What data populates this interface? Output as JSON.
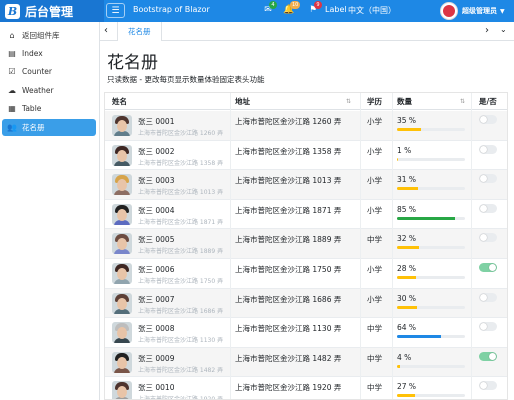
{
  "header": {
    "logo_letter": "B",
    "brand_title": "后台管理",
    "app_name": "Bootstrap of Blazor",
    "icons": [
      {
        "name": "mail-icon",
        "glyph": "✉",
        "badge": "4",
        "color": "#28a745"
      },
      {
        "name": "bell-icon",
        "glyph": "🔔",
        "badge": "10",
        "color": "#f0ad4e"
      },
      {
        "name": "flag-icon",
        "glyph": "⚑",
        "badge": "9",
        "color": "#dc3545"
      }
    ],
    "label_text": "Label",
    "language": "中文（中国）",
    "user_name": "超级管理员"
  },
  "sidebar": {
    "items": [
      {
        "icon": "⌂",
        "icon_name": "home-icon",
        "label": "返回组件库"
      },
      {
        "icon": "▤",
        "icon_name": "document-icon",
        "label": "Index"
      },
      {
        "icon": "☑",
        "icon_name": "checkbox-icon",
        "label": "Counter"
      },
      {
        "icon": "☁",
        "icon_name": "cloud-icon",
        "label": "Weather"
      },
      {
        "icon": "▦",
        "icon_name": "table-icon",
        "label": "Table"
      },
      {
        "icon": "👥",
        "icon_name": "users-icon",
        "label": "花名册"
      }
    ],
    "active_index": 5
  },
  "tabs": {
    "prev": "‹",
    "next": "›",
    "more": "⌄",
    "active_label": "花名册"
  },
  "page": {
    "title": "花名册",
    "description": "只读数据 - 更改每页显示数量体验固定表头功能"
  },
  "table": {
    "columns": {
      "name": "姓名",
      "address": "地址",
      "education": "学历",
      "count": "数量",
      "yes_no": "是/否"
    },
    "sort_glyph": "⇅",
    "rows": [
      {
        "name": "张三 0001",
        "sub": "上海市普陀区金沙江路 1260 弄",
        "address": "上海市普陀区金沙江路 1260 弄",
        "education": "小学",
        "pct_label": "35 %",
        "pct": 35,
        "bar_color": "#ffc107",
        "on": false
      },
      {
        "name": "张三 0002",
        "sub": "上海市普陀区金沙江路 1358 弄",
        "address": "上海市普陀区金沙江路 1358 弄",
        "education": "小学",
        "pct_label": "1 %",
        "pct": 1,
        "bar_color": "#ffc107",
        "on": false
      },
      {
        "name": "张三 0003",
        "sub": "上海市普陀区金沙江路 1013 弄",
        "address": "上海市普陀区金沙江路 1013 弄",
        "education": "小学",
        "pct_label": "31 %",
        "pct": 31,
        "bar_color": "#ffc107",
        "on": false
      },
      {
        "name": "张三 0004",
        "sub": "上海市普陀区金沙江路 1871 弄",
        "address": "上海市普陀区金沙江路 1871 弄",
        "education": "小学",
        "pct_label": "85 %",
        "pct": 85,
        "bar_color": "#28a745",
        "on": false
      },
      {
        "name": "张三 0005",
        "sub": "上海市普陀区金沙江路 1889 弄",
        "address": "上海市普陀区金沙江路 1889 弄",
        "education": "中学",
        "pct_label": "32 %",
        "pct": 32,
        "bar_color": "#ffc107",
        "on": false
      },
      {
        "name": "张三 0006",
        "sub": "上海市普陀区金沙江路 1750 弄",
        "address": "上海市普陀区金沙江路 1750 弄",
        "education": "小学",
        "pct_label": "28 %",
        "pct": 28,
        "bar_color": "#ffc107",
        "on": true
      },
      {
        "name": "张三 0007",
        "sub": "上海市普陀区金沙江路 1686 弄",
        "address": "上海市普陀区金沙江路 1686 弄",
        "education": "小学",
        "pct_label": "30 %",
        "pct": 30,
        "bar_color": "#ffc107",
        "on": false
      },
      {
        "name": "张三 0008",
        "sub": "上海市普陀区金沙江路 1130 弄",
        "address": "上海市普陀区金沙江路 1130 弄",
        "education": "中学",
        "pct_label": "64 %",
        "pct": 64,
        "bar_color": "#1e88e5",
        "on": false
      },
      {
        "name": "张三 0009",
        "sub": "上海市普陀区金沙江路 1482 弄",
        "address": "上海市普陀区金沙江路 1482 弄",
        "education": "中学",
        "pct_label": "4 %",
        "pct": 4,
        "bar_color": "#ffc107",
        "on": true
      },
      {
        "name": "张三 0010",
        "sub": "上海市普陀区金沙江路 1920 弄",
        "address": "上海市普陀区金沙江路 1920 弄",
        "education": "中学",
        "pct_label": "27 %",
        "pct": 27,
        "bar_color": "#ffc107",
        "on": false
      }
    ]
  }
}
